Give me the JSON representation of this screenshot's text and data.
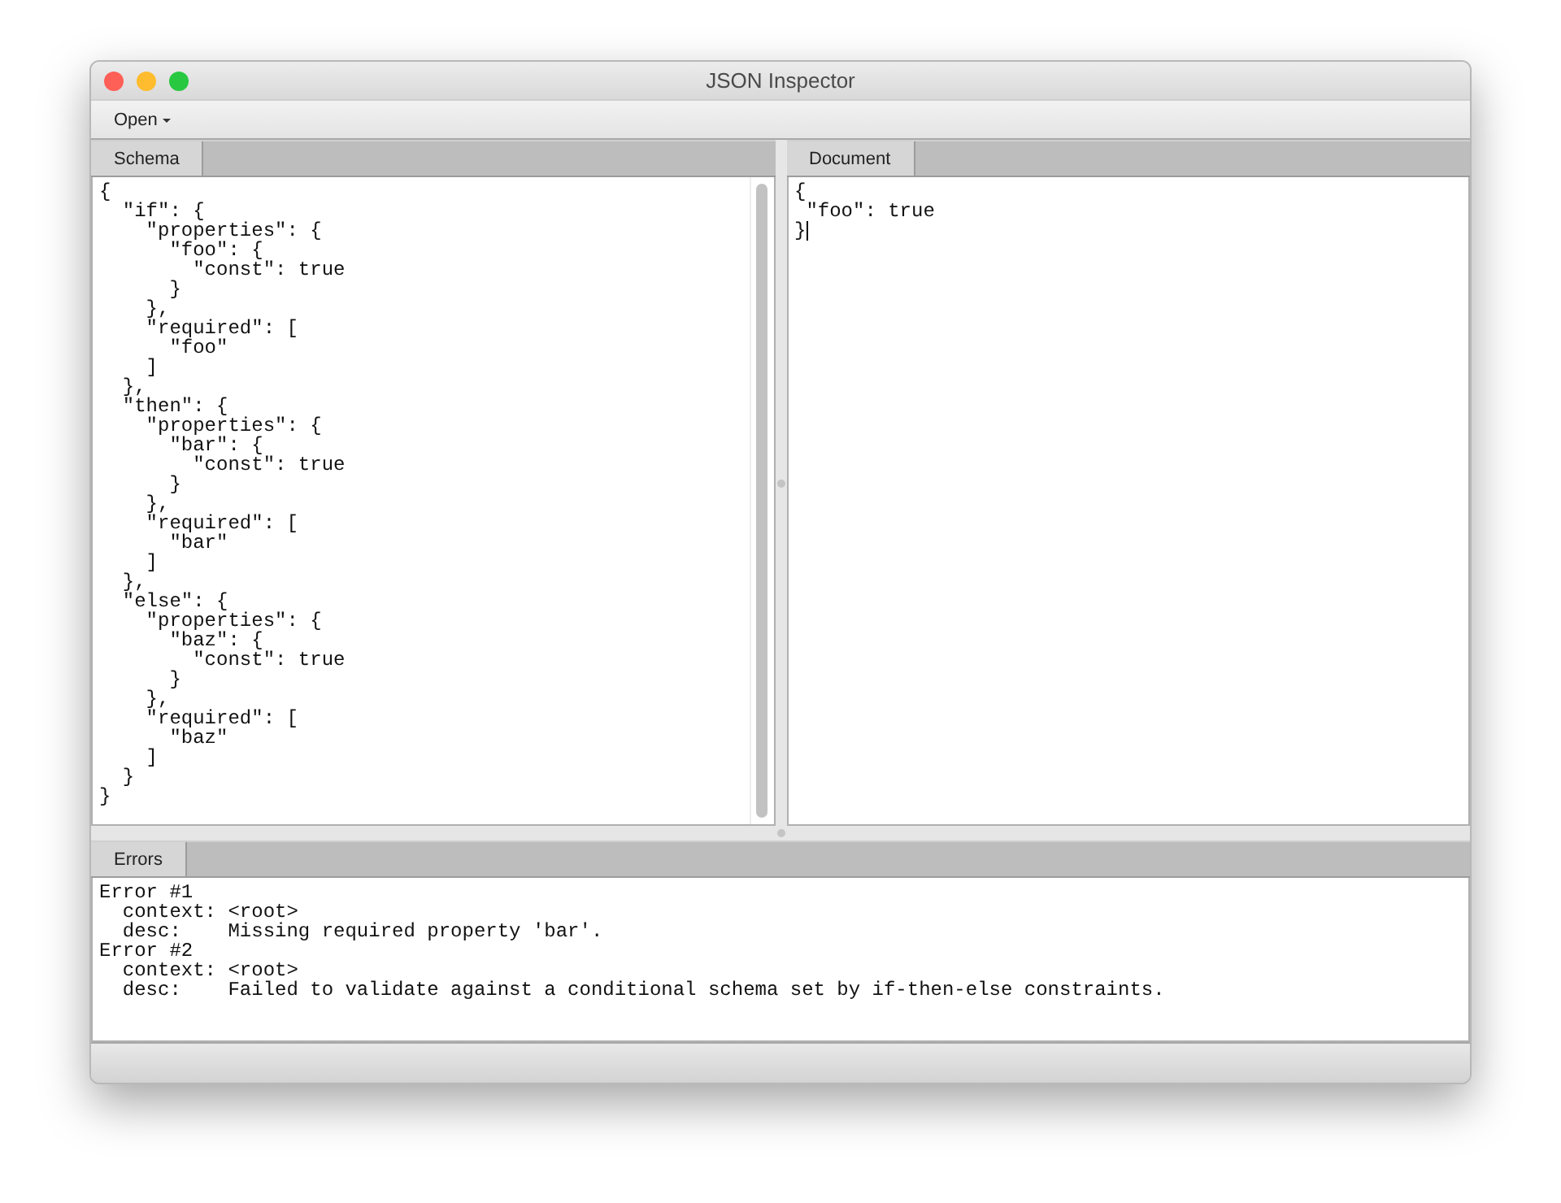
{
  "window": {
    "title": "JSON Inspector"
  },
  "toolbar": {
    "menu": "Open"
  },
  "schema": {
    "tab": "Schema",
    "lines": [
      "{",
      "  \"if\": {",
      "    \"properties\": {",
      "      \"foo\": {",
      "        \"const\": true",
      "      }",
      "    },",
      "    \"required\": [",
      "      \"foo\"",
      "    ]",
      "  },",
      "  \"then\": {",
      "    \"properties\": {",
      "      \"bar\": {",
      "        \"const\": true",
      "      }",
      "    },",
      "    \"required\": [",
      "      \"bar\"",
      "    ]",
      "  },",
      "  \"else\": {",
      "    \"properties\": {",
      "      \"baz\": {",
      "        \"const\": true",
      "      }",
      "    },",
      "    \"required\": [",
      "      \"baz\"",
      "    ]",
      "  }",
      "}"
    ]
  },
  "document": {
    "tab": "Document",
    "lines": [
      "{",
      " \"foo\": true",
      "}"
    ]
  },
  "errors": {
    "tab": "Errors",
    "lines": [
      "Error #1",
      "  context: <root>",
      "  desc:    Missing required property 'bar'.",
      "Error #2",
      "  context: <root>",
      "  desc:    Failed to validate against a conditional schema set by if-then-else constraints."
    ]
  }
}
